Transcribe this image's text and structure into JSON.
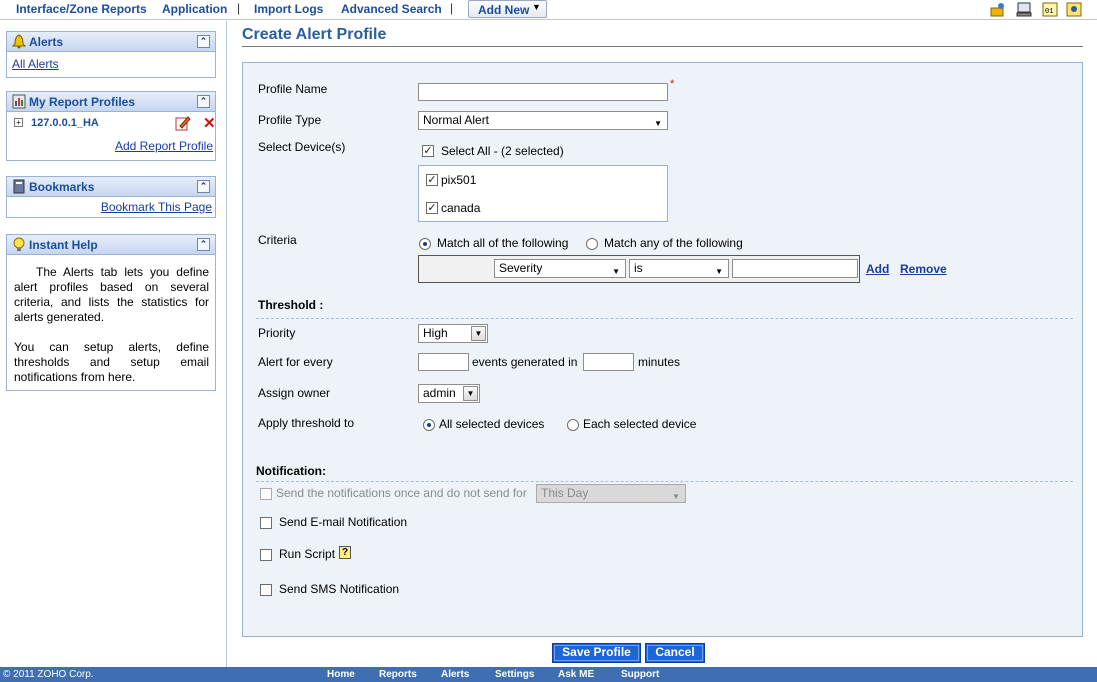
{
  "topnav": {
    "items": [
      "Interface/Zone Reports",
      "Application",
      "Import Logs",
      "Advanced Search"
    ],
    "add_new": "Add New",
    "icons": [
      "manage-icon",
      "computer-icon",
      "binary-icon",
      "help-icon"
    ]
  },
  "sidebar": {
    "alerts": {
      "title": "Alerts",
      "link": "All Alerts"
    },
    "report_profiles": {
      "title": "My Report Profiles",
      "item": "127.0.0.1_HA",
      "link": "Add Report Profile"
    },
    "bookmarks": {
      "title": "Bookmarks",
      "link": "Bookmark This Page"
    },
    "help": {
      "title": "Instant Help",
      "text1": "The Alerts tab lets you define alert profiles based on several criteria, and lists the statistics for alerts generated.",
      "text2": "You can setup alerts, define thresholds and setup email notifications from here."
    }
  },
  "main": {
    "title": "Create Alert Profile",
    "profile_name": {
      "label": "Profile Name",
      "value": "",
      "required": "*"
    },
    "profile_type": {
      "label": "Profile Type",
      "value": "Normal Alert"
    },
    "devices": {
      "label": "Select Device(s)",
      "select_all": "Select All - (2 selected)",
      "items": [
        "pix501",
        "canada"
      ]
    },
    "criteria": {
      "label": "Criteria",
      "match_all": "Match all of the following",
      "match_any": "Match any of the following",
      "field": "Severity",
      "operator": "is",
      "value": "",
      "add": "Add",
      "remove": "Remove"
    },
    "threshold": {
      "heading": "Threshold :",
      "priority_label": "Priority",
      "priority_value": "High",
      "alert_every_label": "Alert for every",
      "events_text": "events generated in",
      "minutes_text": "minutes",
      "owner_label": "Assign owner",
      "owner_value": "admin",
      "apply_label": "Apply threshold to",
      "apply_all": "All selected devices",
      "apply_each": "Each selected device"
    },
    "notification": {
      "heading": "Notification:",
      "once_text": "Send the notifications once and do not send for",
      "once_value": "This Day",
      "email": "Send E-mail Notification",
      "script": "Run Script",
      "sms": "Send SMS Notification"
    },
    "save_button": "Save Profile",
    "cancel_button": "Cancel"
  },
  "footer": {
    "copyright": "© 2011 ZOHO Corp.",
    "links": [
      "Home",
      "Reports",
      "Alerts",
      "Settings",
      "Ask ME",
      "Support"
    ]
  },
  "colors": {
    "accent": "#1a4d9c",
    "button": "#1f65d8",
    "footer": "#3f6eb3",
    "panel": "#eef3fa"
  }
}
